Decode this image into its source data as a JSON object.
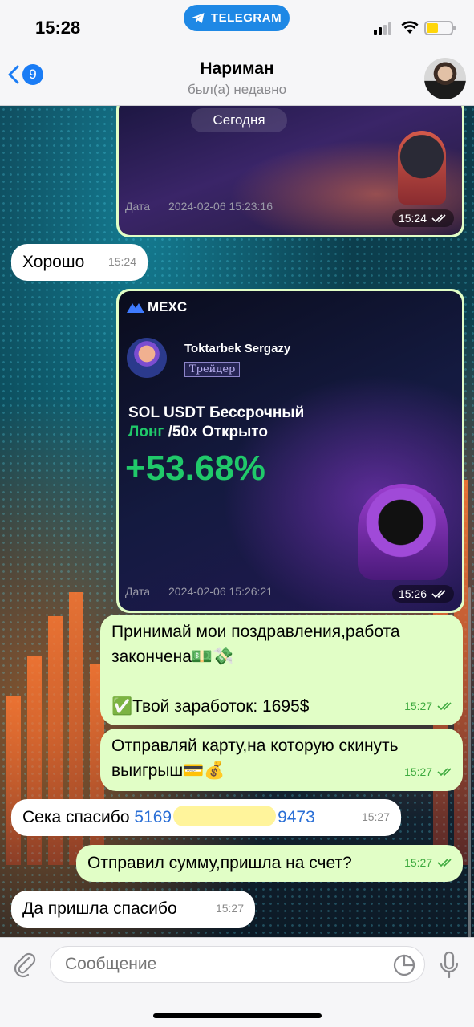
{
  "status_bar": {
    "time": "15:28",
    "app_pill": "TELEGRAM"
  },
  "header": {
    "back_count": "9",
    "name": "Нариман",
    "status": "был(а) недавно"
  },
  "messages": {
    "card1": {
      "title_partial": "Сегодня",
      "date_label": "Дата",
      "date_value": "2024-02-06 15:23:16",
      "time": "15:24"
    },
    "m1": {
      "text": "Хорошо",
      "time": "15:24"
    },
    "card2": {
      "brand": "MEXC",
      "trader_name": "Toktarbek Sergazy",
      "trader_badge": "Трейдер",
      "pair_line1": "SOL USDT Бессрочный",
      "pair_long": "Лонг",
      "pair_line2_rest": " /50x Открыто",
      "pnl": "+53.68%",
      "date_label": "Дата",
      "date_value": "2024-02-06 15:26:21",
      "time": "15:26"
    },
    "m2": {
      "line1": "Принимай мои поздравления,работа",
      "line2": "закончена💵💸",
      "line3": "✅Твой заработок: 1695$",
      "time": "15:27"
    },
    "m3": {
      "line1": "Отправляй карту,на которую скинуть",
      "line2": "выигрыш💳💰",
      "time": "15:27"
    },
    "m4": {
      "text": "Сека спасибо ",
      "card_start": "5169",
      "card_end": "9473",
      "time": "15:27"
    },
    "m5": {
      "text": "Отправил сумму,пришла на счет?",
      "time": "15:27"
    },
    "m6": {
      "text": "Да пришла спасибо",
      "time": "15:27"
    }
  },
  "input": {
    "placeholder": "Сообщение"
  },
  "colors": {
    "accent": "#1a7cf5",
    "outgoing_bubble": "#e1fec6",
    "incoming_bubble": "#ffffff",
    "mexc_green": "#20c96a"
  }
}
